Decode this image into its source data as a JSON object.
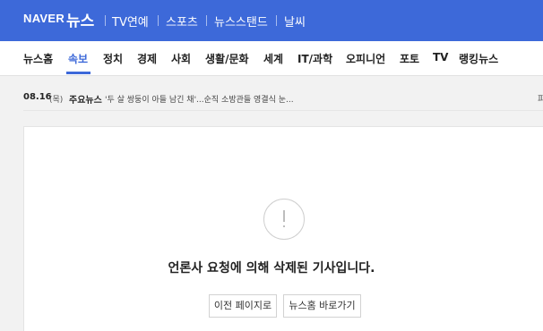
{
  "header": {
    "logo": "NAVER",
    "brand": "뉴스",
    "nav": [
      "TV연예",
      "스포츠",
      "뉴스스탠드",
      "날씨"
    ],
    "bg_color": "#3d69d9"
  },
  "categories": {
    "items": [
      "뉴스홈",
      "속보",
      "정치",
      "경제",
      "사회",
      "생활/문화",
      "세계",
      "IT/과학",
      "오피니언",
      "포토",
      "TV",
      "랭킹뉴스"
    ],
    "active": "속보"
  },
  "ticker": {
    "date": "08.16",
    "day": "(목)",
    "label": "주요뉴스",
    "headline": "'두 살 쌍둥이 아들 남긴 채'...순직 소방관들 영결식 눈...",
    "right_text": "파"
  },
  "notice": {
    "icon": "alert-icon",
    "message": "언론사 요청에 의해 삭제된 기사입니다.",
    "buttons": {
      "prev": "이전 페이지로",
      "home": "뉴스홈 바로가기"
    }
  }
}
